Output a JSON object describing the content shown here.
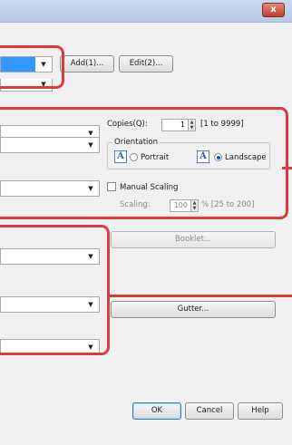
{
  "titlebar": {
    "close_label": "x"
  },
  "profile": {
    "add_label": "Add(1)...",
    "edit_label": "Edit(2)..."
  },
  "copies": {
    "label": "Copies(Q):",
    "value": "1",
    "range": "[1 to 9999]"
  },
  "orientation": {
    "legend": "Orientation",
    "portrait_icon": "A",
    "portrait_label": "Portrait",
    "landscape_icon": "A",
    "landscape_label": "Landscape",
    "selected": "Landscape"
  },
  "scaling": {
    "manual_label": "Manual Scaling",
    "scaling_label": "Scaling:",
    "value": "100",
    "range": "% [25 to 200]"
  },
  "buttons": {
    "booklet": "Booklet...",
    "gutter": "Gutter...",
    "ok": "OK",
    "cancel": "Cancel",
    "help": "Help"
  },
  "colors": {
    "highlight": "#d83c3e",
    "selection": "#3399ff",
    "titlebar": "#c2d4ec"
  },
  "icons": [
    "close-icon",
    "chevron-down-icon",
    "spin-up-icon",
    "spin-down-icon",
    "orientation-a-icon"
  ]
}
